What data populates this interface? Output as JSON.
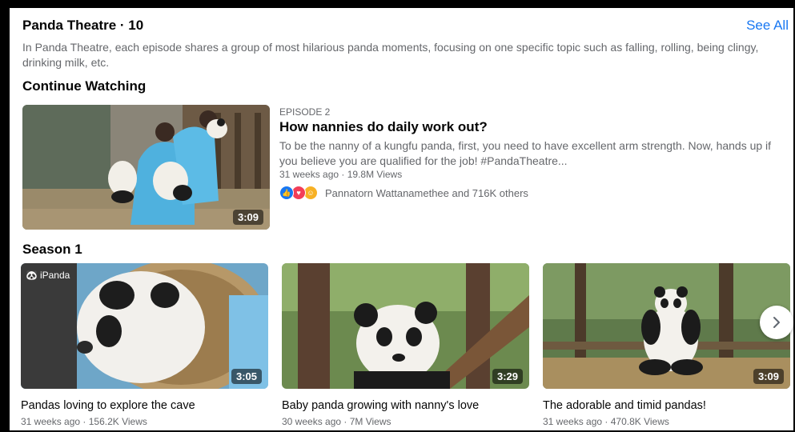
{
  "header": {
    "title": "Panda Theatre · 10",
    "see_all": "See All",
    "description": "In Panda Theatre, each episode shares a group of most hilarious panda moments, focusing on one specific topic such as falling, rolling, being clingy, drinking milk, etc."
  },
  "continue_watching": {
    "heading": "Continue Watching",
    "episode_label": "EPISODE 2",
    "title": "How nannies do daily work out?",
    "description": "To be the nanny of a kungfu panda, first, you need to have excellent arm strength. Now, hands up if you believe you are qualified for the job! #PandaTheatre...",
    "meta": "31 weeks ago · 19.8M Views",
    "duration": "3:09",
    "reactions": {
      "icons": [
        "like-icon",
        "love-icon",
        "haha-icon"
      ],
      "text": "Pannatorn Wattanamethee and 716K others"
    }
  },
  "season": {
    "heading": "Season 1",
    "videos": [
      {
        "title": "Pandas loving to explore the cave",
        "meta": "31 weeks ago · 156.2K Views",
        "duration": "3:05",
        "badge": "iPanda"
      },
      {
        "title": "Baby panda growing with nanny's love",
        "meta": "30 weeks ago · 7M Views",
        "duration": "3:29"
      },
      {
        "title": "The adorable and timid pandas!",
        "meta": "31 weeks ago · 470.8K Views",
        "duration": "3:09"
      }
    ],
    "next_icon": "chevron-right-icon"
  },
  "colors": {
    "link": "#1877f2",
    "text_primary": "#050505",
    "text_secondary": "#65676b"
  }
}
